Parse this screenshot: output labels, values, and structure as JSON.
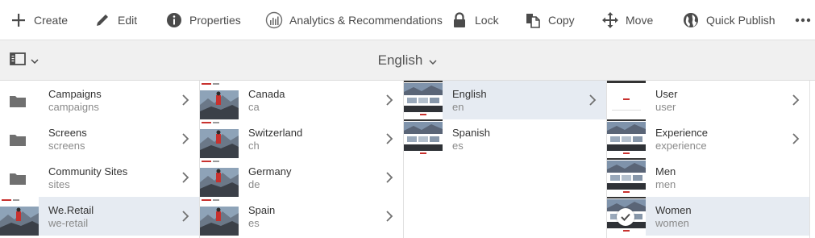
{
  "toolbar": {
    "items": [
      {
        "label": "Create",
        "icon": "plus-icon"
      },
      {
        "label": "Edit",
        "icon": "pencil-icon"
      },
      {
        "label": "Properties",
        "icon": "info-icon"
      },
      {
        "label": "Analytics & Recommendations",
        "icon": "analytics-icon"
      },
      {
        "label": "Lock",
        "icon": "lock-icon"
      },
      {
        "label": "Copy",
        "icon": "copy-icon"
      },
      {
        "label": "Move",
        "icon": "move-icon"
      },
      {
        "label": "Quick Publish",
        "icon": "globe-icon"
      }
    ],
    "more_icon": "more-icon"
  },
  "subheader": {
    "title": "English"
  },
  "columns": [
    {
      "rows": [
        {
          "name": "Campaigns",
          "sub": "campaigns",
          "thumb": "folder",
          "selected": false,
          "has_children": true
        },
        {
          "name": "Screens",
          "sub": "screens",
          "thumb": "folder",
          "selected": false,
          "has_children": true
        },
        {
          "name": "Community Sites",
          "sub": "sites",
          "thumb": "folder",
          "selected": false,
          "has_children": true
        },
        {
          "name": "We.Retail",
          "sub": "we-retail",
          "thumb": "hero",
          "selected": true,
          "has_children": true
        }
      ]
    },
    {
      "rows": [
        {
          "name": "Canada",
          "sub": "ca",
          "thumb": "hero",
          "selected": false,
          "has_children": true
        },
        {
          "name": "Switzerland",
          "sub": "ch",
          "thumb": "hero",
          "selected": false,
          "has_children": true
        },
        {
          "name": "Germany",
          "sub": "de",
          "thumb": "hero",
          "selected": false,
          "has_children": true
        },
        {
          "name": "Spain",
          "sub": "es",
          "thumb": "hero",
          "selected": false,
          "has_children": true
        }
      ]
    },
    {
      "rows": [
        {
          "name": "English",
          "sub": "en",
          "thumb": "page",
          "selected": true,
          "has_children": true
        },
        {
          "name": "Spanish",
          "sub": "es",
          "thumb": "page",
          "selected": false,
          "has_children": false
        }
      ]
    },
    {
      "rows": [
        {
          "name": "User",
          "sub": "user",
          "thumb": "page-white",
          "selected": false,
          "has_children": true
        },
        {
          "name": "Experience",
          "sub": "experience",
          "thumb": "page",
          "selected": false,
          "has_children": true
        },
        {
          "name": "Men",
          "sub": "men",
          "thumb": "page",
          "selected": false,
          "has_children": false
        },
        {
          "name": "Women",
          "sub": "women",
          "thumb": "page",
          "selected": true,
          "checked": true,
          "has_children": false
        }
      ]
    }
  ],
  "colors": {
    "selected_row": "#e6ebf2",
    "brand_red": "#e33b36"
  }
}
